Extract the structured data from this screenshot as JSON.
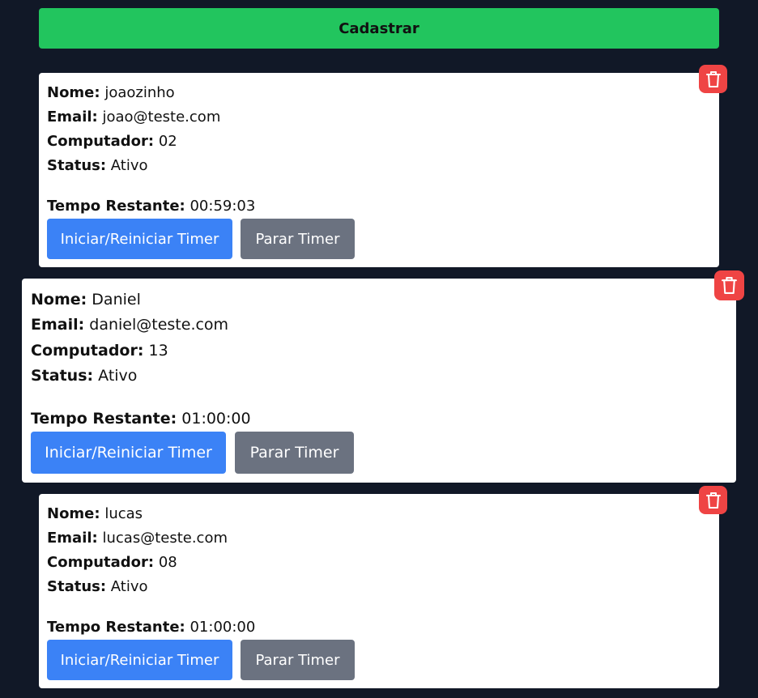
{
  "register_button": {
    "label": "Cadastrar"
  },
  "field_labels": {
    "name": "Nome:",
    "email": "Email:",
    "computer": "Computador:",
    "status": "Status:",
    "time_remaining": "Tempo Restante:"
  },
  "actions": {
    "start_label": "Iniciar/Reiniciar Timer",
    "stop_label": "Parar Timer"
  },
  "icons": {
    "delete": "trash-icon"
  },
  "colors": {
    "background": "#111827",
    "register": "#22c55e",
    "start": "#3b82f6",
    "stop": "#6b7280",
    "delete": "#ef4444"
  },
  "users": [
    {
      "name": "joaozinho",
      "email": "joao@teste.com",
      "computer": "02",
      "status": "Ativo",
      "time_remaining": "00:59:03"
    },
    {
      "name": "Daniel",
      "email": "daniel@teste.com",
      "computer": "13",
      "status": "Ativo",
      "time_remaining": "01:00:00"
    },
    {
      "name": "lucas",
      "email": "lucas@teste.com",
      "computer": "08",
      "status": "Ativo",
      "time_remaining": "01:00:00"
    }
  ]
}
